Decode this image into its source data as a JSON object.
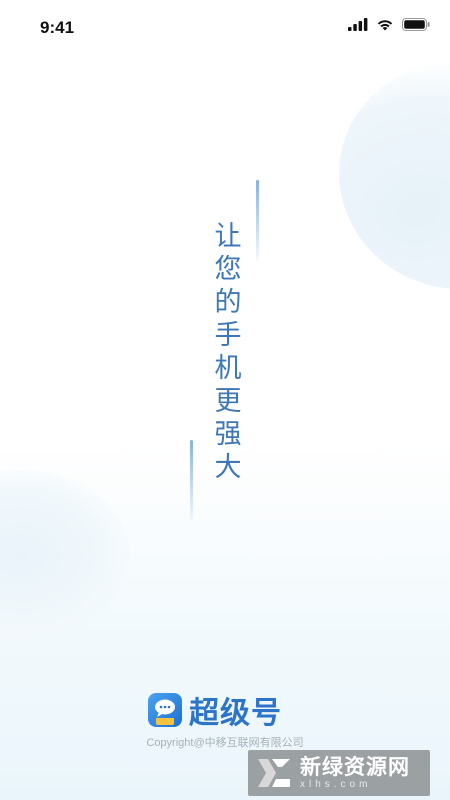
{
  "status_bar": {
    "time": "9:41",
    "icons": [
      "cellular-signal-icon",
      "wifi-icon",
      "battery-icon"
    ]
  },
  "slogan": {
    "characters": [
      "让",
      "您",
      "的",
      "手",
      "机",
      "更",
      "强",
      "大"
    ]
  },
  "brand": {
    "logo_icon": "chat-bubble-logo-icon",
    "name": "超级号",
    "accent_color": "#2b74c9"
  },
  "footer": {
    "copyright": "Copyright@中移互联网有限公司"
  },
  "watermark": {
    "title": "新绿资源网",
    "url": "xlhs.com"
  },
  "colors": {
    "slogan_text": "#3d77b6",
    "background_tint": "#eaf5fb"
  }
}
